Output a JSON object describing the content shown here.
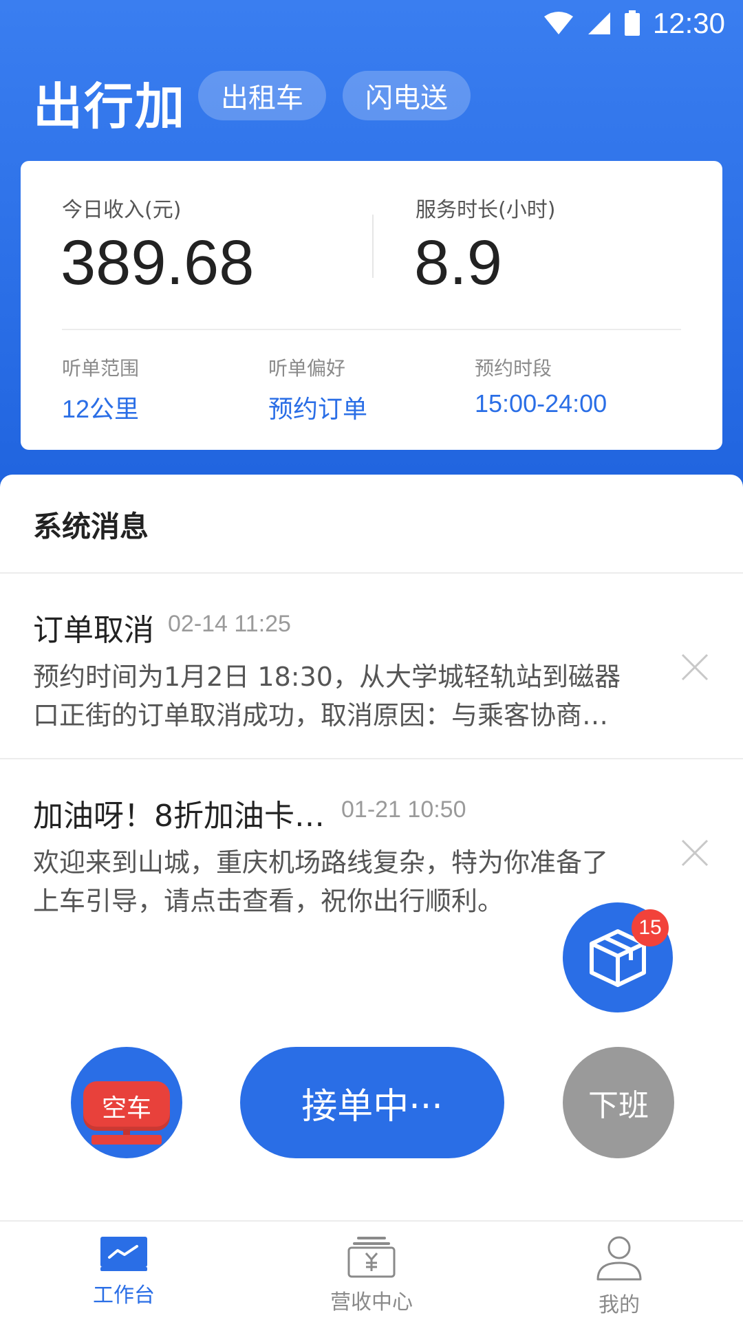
{
  "status_bar": {
    "time": "12:30"
  },
  "header": {
    "app_title": "出行加",
    "tabs": [
      {
        "label": "出租车"
      },
      {
        "label": "闪电送"
      }
    ]
  },
  "stats": {
    "income_label": "今日收入(元)",
    "income_value": "389.68",
    "duration_label": "服务时长(小时)",
    "duration_value": "8.9",
    "settings": [
      {
        "label": "听单范围",
        "value": "12公里"
      },
      {
        "label": "听单偏好",
        "value": "预约订单"
      },
      {
        "label": "预约时段",
        "value": "15:00-24:00"
      }
    ]
  },
  "messages": {
    "section_title": "系统消息",
    "items": [
      {
        "title": "订单取消",
        "time": "02-14 11:25",
        "body_line1": "预约时间为1月2日 18:30，从大学城轻轨站到磁器",
        "body_line2": "口正街的订单取消成功，取消原因：与乘客协商…"
      },
      {
        "title": "加油呀！8折加油卡…",
        "time": "01-21 10:50",
        "body_line1": "欢迎来到山城，重庆机场路线复杂，特为你准备了",
        "body_line2": "上车引导，请点击查看，祝你出行顺利。"
      }
    ]
  },
  "floating": {
    "badge_count": "15"
  },
  "actions": {
    "empty_car_label": "空车",
    "accept_label": "接单中···",
    "off_duty_label": "下班"
  },
  "nav": {
    "items": [
      {
        "label": "工作台",
        "icon": "workbench-icon",
        "active": true
      },
      {
        "label": "营收中心",
        "icon": "revenue-icon",
        "active": false
      },
      {
        "label": "我的",
        "icon": "profile-icon",
        "active": false
      }
    ],
    "active_color": "#2a6ee6",
    "inactive_color": "#8a8a8a"
  },
  "colors": {
    "primary": "#2a6ee6",
    "badge": "#f2423a",
    "off_duty": "#9a9a9a"
  }
}
